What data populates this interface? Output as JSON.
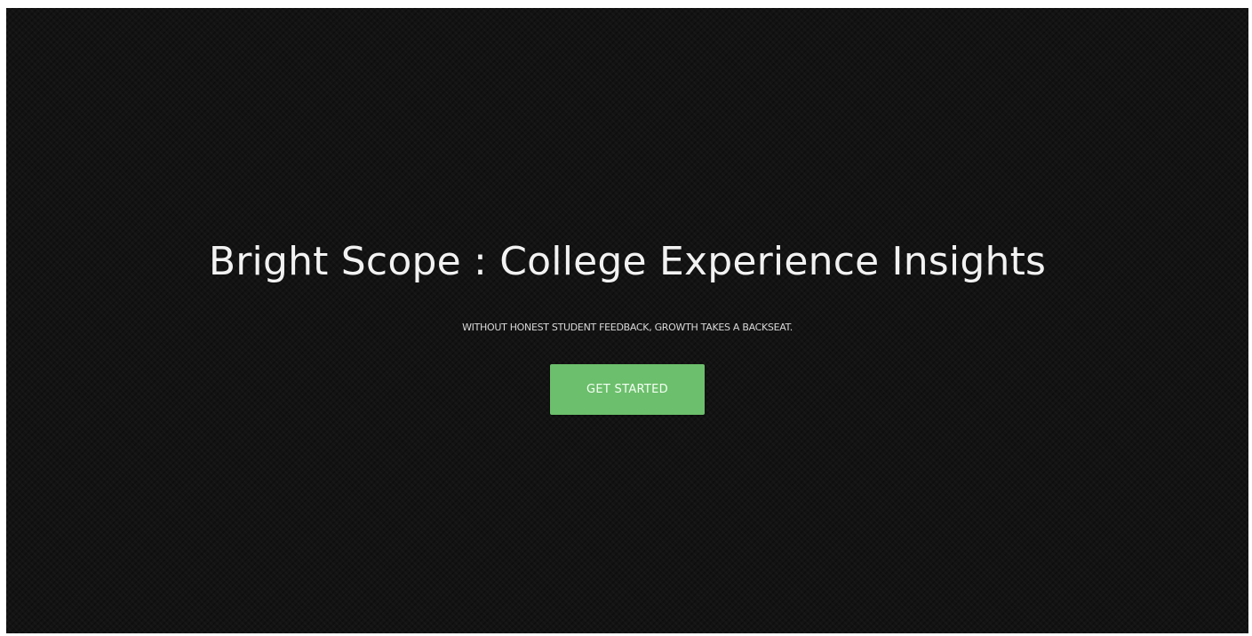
{
  "hero": {
    "title": "Bright Scope : College Experience Insights",
    "tagline": "WITHOUT HONEST STUDENT FEEDBACK, GROWTH TAKES A BACKSEAT.",
    "cta_label": "GET STARTED"
  },
  "colors": {
    "background": "#131313",
    "title_text": "#f2f2f2",
    "cta_background": "#6cbf6c",
    "cta_text": "#f4fff4"
  }
}
